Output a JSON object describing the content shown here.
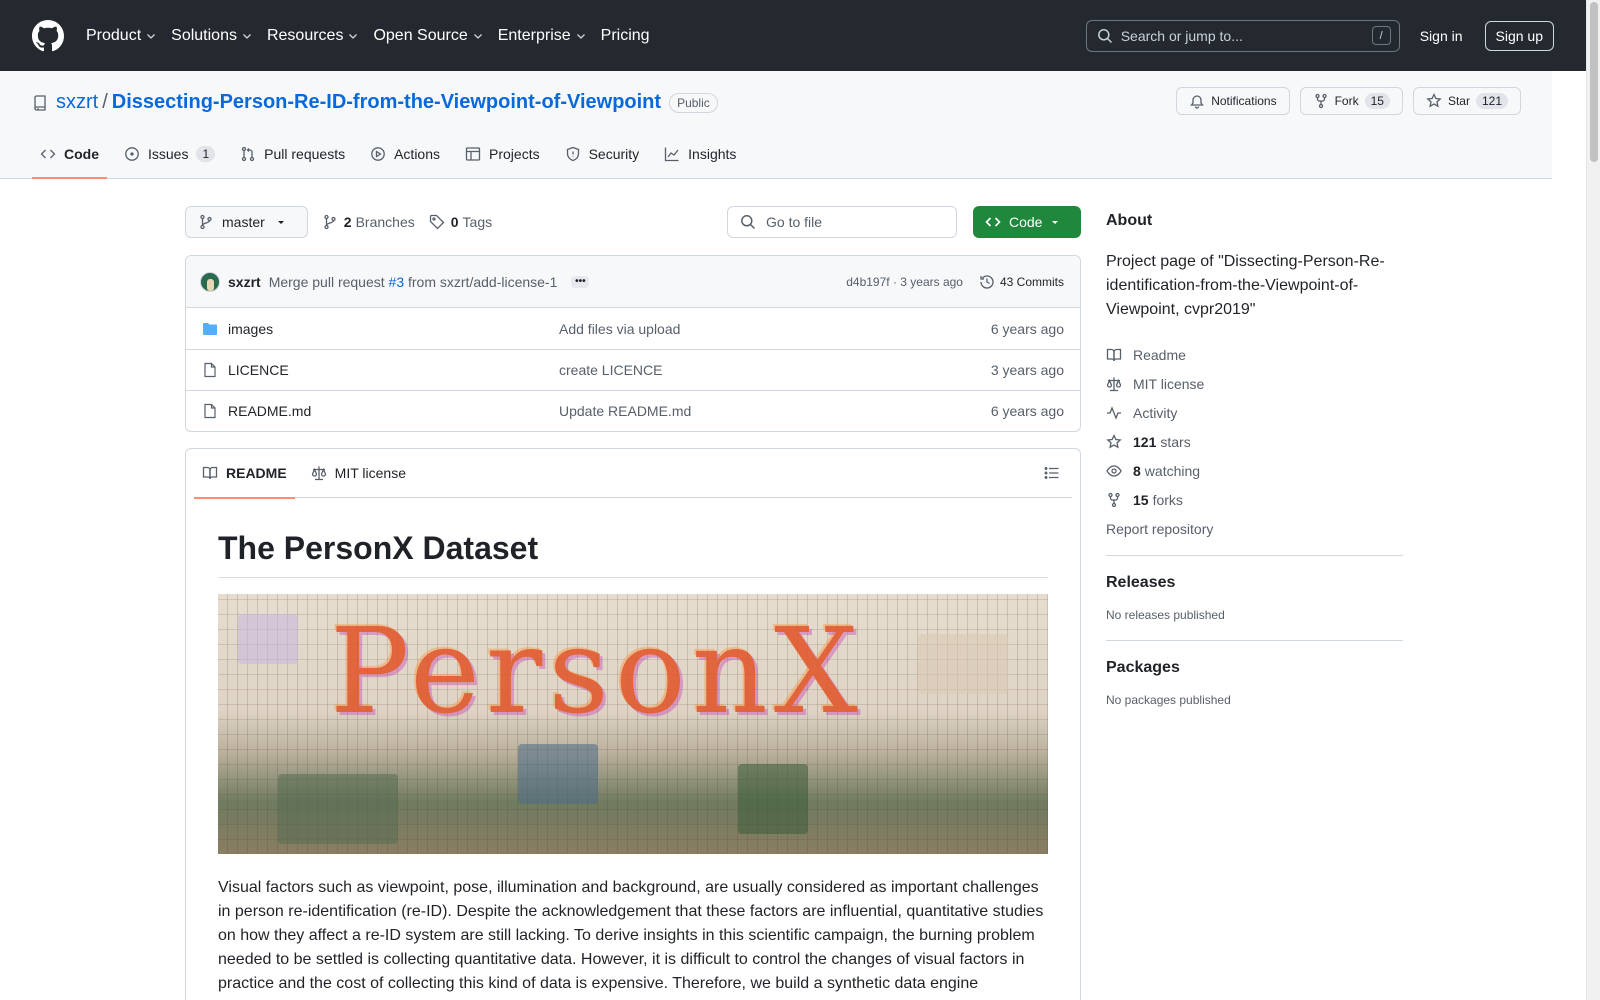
{
  "header": {
    "nav": [
      {
        "label": "Product",
        "has_menu": true
      },
      {
        "label": "Solutions",
        "has_menu": true
      },
      {
        "label": "Resources",
        "has_menu": true
      },
      {
        "label": "Open Source",
        "has_menu": true
      },
      {
        "label": "Enterprise",
        "has_menu": true
      },
      {
        "label": "Pricing",
        "has_menu": false
      }
    ],
    "search_placeholder": "Search or jump to...",
    "search_key": "/",
    "sign_in": "Sign in",
    "sign_up": "Sign up"
  },
  "repo": {
    "owner": "sxzrt",
    "separator": "/",
    "name": "Dissecting-Person-Re-ID-from-the-Viewpoint-of-Viewpoint",
    "visibility": "Public",
    "actions": {
      "notifications": "Notifications",
      "fork_label": "Fork",
      "fork_count": "15",
      "star_label": "Star",
      "star_count": "121"
    },
    "tabs": [
      {
        "label": "Code",
        "icon": "code-icon",
        "active": true,
        "count": ""
      },
      {
        "label": "Issues",
        "icon": "issue-icon",
        "active": false,
        "count": "1"
      },
      {
        "label": "Pull requests",
        "icon": "pull-request-icon",
        "active": false,
        "count": ""
      },
      {
        "label": "Actions",
        "icon": "play-icon",
        "active": false,
        "count": ""
      },
      {
        "label": "Projects",
        "icon": "table-icon",
        "active": false,
        "count": ""
      },
      {
        "label": "Security",
        "icon": "shield-icon",
        "active": false,
        "count": ""
      },
      {
        "label": "Insights",
        "icon": "graph-icon",
        "active": false,
        "count": ""
      }
    ]
  },
  "toolbar": {
    "branch": "master",
    "branches_count": "2",
    "branches_label": "Branches",
    "tags_count": "0",
    "tags_label": "Tags",
    "goto_placeholder": "Go to file",
    "code_button": "Code"
  },
  "latest_commit": {
    "author": "sxzrt",
    "message_prefix": "Merge pull request",
    "pr_ref": "#3",
    "message_suffix": "from sxzrt/add-license-1",
    "sha_and_age": "d4b197f · 3 years ago",
    "commits_label": "43 Commits"
  },
  "files": [
    {
      "type": "folder",
      "name": "images",
      "commit": "Add files via upload",
      "age": "6 years ago"
    },
    {
      "type": "file",
      "name": "LICENCE",
      "commit": "create LICENCE",
      "age": "3 years ago"
    },
    {
      "type": "file",
      "name": "README.md",
      "commit": "Update README.md",
      "age": "6 years ago"
    }
  ],
  "readme": {
    "tabs": [
      {
        "label": "README",
        "icon": "book-icon",
        "active": true
      },
      {
        "label": "MIT license",
        "icon": "law-icon",
        "active": false
      }
    ],
    "title": "The PersonX Dataset",
    "banner_text": "PersonX",
    "paragraph": "Visual factors such as viewpoint, pose, illumination and background, are usually considered as important challenges in person re-identification (re-ID). Despite the acknowledgement that these factors are influential, quantitative studies on how they affect a re-ID system are still lacking. To derive insights in this scientific campaign, the burning problem needed to be settled is collecting quantitative data. However, it is difficult to control the changes of visual factors in practice and the cost of collecting this kind of data is expensive. Therefore, we build a synthetic data engine"
  },
  "sidebar": {
    "about_title": "About",
    "description": "Project page of \"Dissecting-Person-Re-identification-from-the-Viewpoint-of-Viewpoint, cvpr2019\"",
    "items": [
      {
        "icon": "book-icon",
        "strong": "",
        "label": "Readme"
      },
      {
        "icon": "law-icon",
        "strong": "",
        "label": "MIT license"
      },
      {
        "icon": "pulse-icon",
        "strong": "",
        "label": "Activity"
      },
      {
        "icon": "star-icon",
        "strong": "121",
        "label": "stars"
      },
      {
        "icon": "eye-icon",
        "strong": "8",
        "label": "watching"
      },
      {
        "icon": "fork-icon",
        "strong": "15",
        "label": "forks"
      }
    ],
    "report": "Report repository",
    "releases_title": "Releases",
    "releases_text": "No releases published",
    "packages_title": "Packages",
    "packages_text": "No packages published"
  },
  "colors": {
    "header_bg": "#24292f",
    "link": "#0969da",
    "primary_button": "#1f883d",
    "tab_underline": "#fd8c73"
  }
}
